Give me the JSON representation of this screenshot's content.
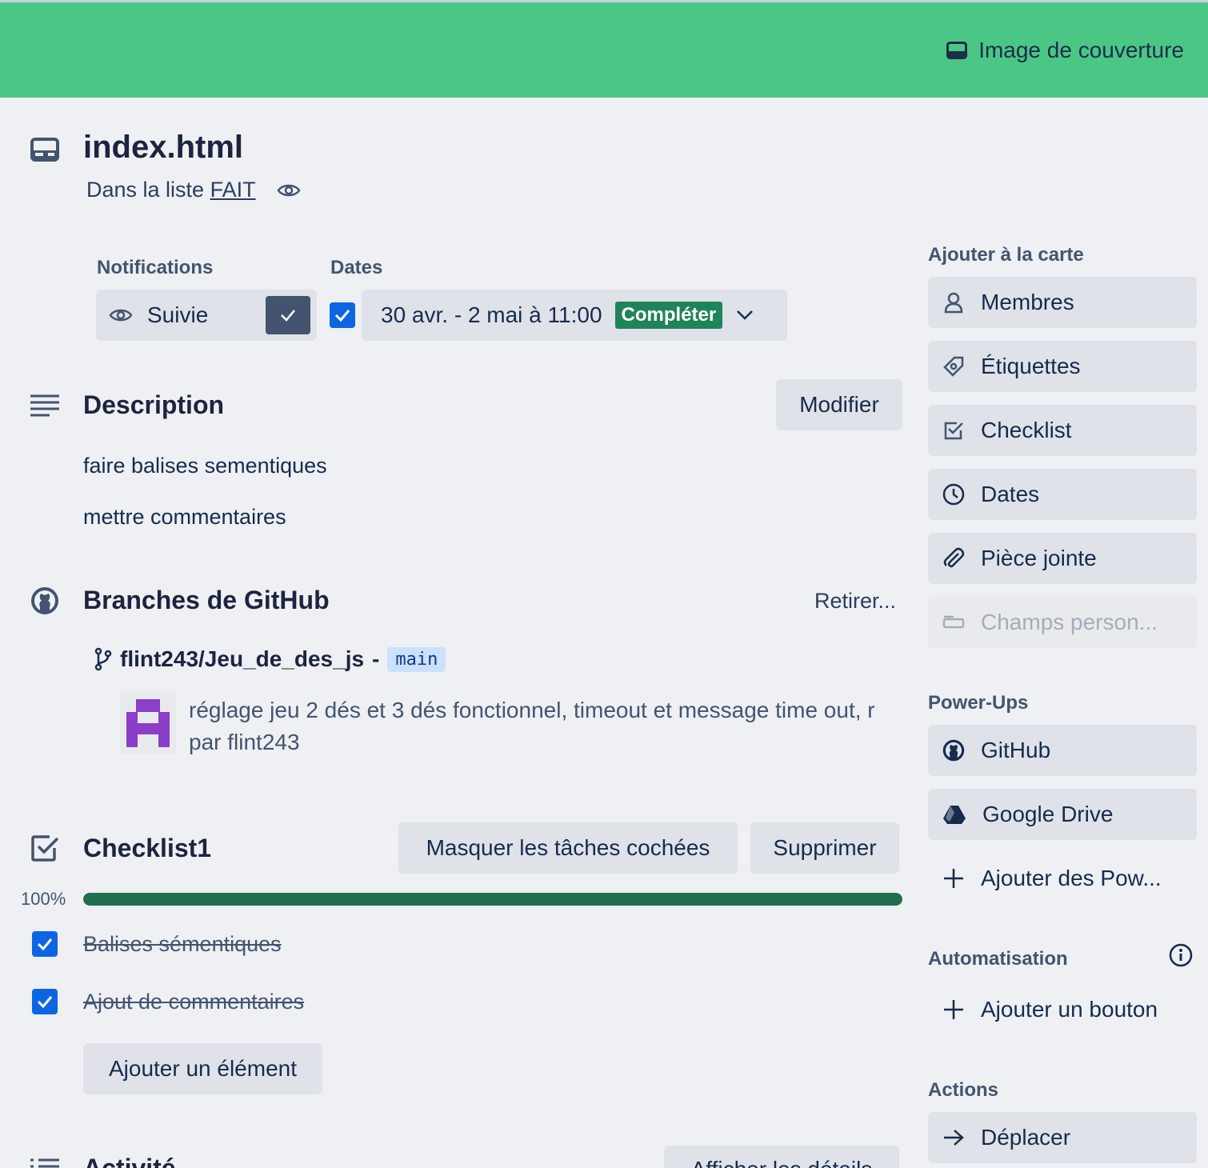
{
  "cover": {
    "button_label": "Image de couverture"
  },
  "card": {
    "title": "index.html",
    "in_list_prefix": "Dans la liste",
    "list_name": "FAIT"
  },
  "notifications": {
    "label": "Notifications",
    "button_label": "Suivie",
    "checked": true
  },
  "dates": {
    "label": "Dates",
    "value": "30 avr. - 2 mai à 11:00",
    "status": "Compléter",
    "checked": true
  },
  "description": {
    "heading": "Description",
    "edit_label": "Modifier",
    "lines": [
      "faire balises sementiques",
      "mettre commentaires"
    ]
  },
  "github": {
    "heading": "Branches de GitHub",
    "remove_label": "Retirer...",
    "repo": "flint243/Jeu_de_des_js",
    "separator": "-",
    "branch": "main",
    "commit_message": "réglage jeu 2 dés et 3 dés fonctionnel, timeout et message time out, r",
    "commit_author": "par flint243"
  },
  "checklist": {
    "heading": "Checklist1",
    "hide_label": "Masquer les tâches cochées",
    "delete_label": "Supprimer",
    "progress_text": "100%",
    "progress": 1.0,
    "items": [
      {
        "label": "Balises sémentiques",
        "checked": true
      },
      {
        "label": "Ajout de commentaires",
        "checked": true
      }
    ],
    "add_label": "Ajouter un élément"
  },
  "activity": {
    "heading": "Activité",
    "details_label": "Afficher les détails"
  },
  "sidebar": {
    "add_to_card_label": "Ajouter à la carte",
    "add_items": [
      "Membres",
      "Étiquettes",
      "Checklist",
      "Dates",
      "Pièce jointe",
      "Champs person..."
    ],
    "powerups_label": "Power-Ups",
    "powerups": [
      "GitHub",
      "Google Drive"
    ],
    "add_powerups_label": "Ajouter des Pow...",
    "automation_label": "Automatisation",
    "add_button_label": "Ajouter un bouton",
    "actions_label": "Actions",
    "actions": [
      "Déplacer"
    ]
  },
  "colors": {
    "cover": "#4bc785",
    "progress": "#216e4e",
    "checkbox": "#0c66e4",
    "badge": "#1f845a"
  }
}
